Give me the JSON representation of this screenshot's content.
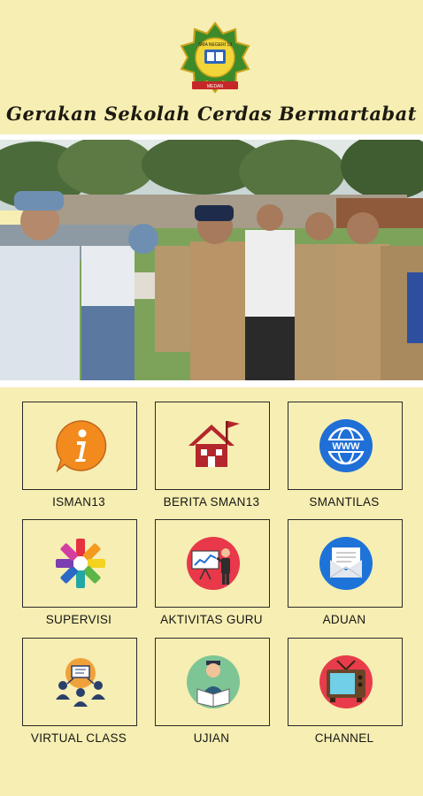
{
  "header": {
    "logo_text_top": "SMA NEGERI 13",
    "logo_text_bottom": "MEDAN",
    "tagline": "Gerakan Sekolah Cerdas Bermartabat"
  },
  "menu": [
    {
      "label": "ISMAN13",
      "icon": "info-icon"
    },
    {
      "label": "BERITA SMAN13",
      "icon": "house-flag-icon"
    },
    {
      "label": "SMANTILAS",
      "icon": "www-globe-icon"
    },
    {
      "label": "SUPERVISI",
      "icon": "colorful-star-icon"
    },
    {
      "label": "AKTIVITAS GURU",
      "icon": "teacher-presentation-icon"
    },
    {
      "label": "ADUAN",
      "icon": "envelope-icon"
    },
    {
      "label": "VIRTUAL CLASS",
      "icon": "virtual-class-icon"
    },
    {
      "label": "UJIAN",
      "icon": "student-reading-icon"
    },
    {
      "label": "CHANNEL",
      "icon": "tv-icon"
    }
  ],
  "colors": {
    "background": "#f6eeb2",
    "info_orange": "#f28a1e",
    "house_red": "#b3262b",
    "globe_blue": "#1f6fd6",
    "teacher_red": "#e8384a",
    "envelope_blue": "#1e73d8",
    "student_green": "#7ec596",
    "tv_red": "#e83c4b"
  }
}
